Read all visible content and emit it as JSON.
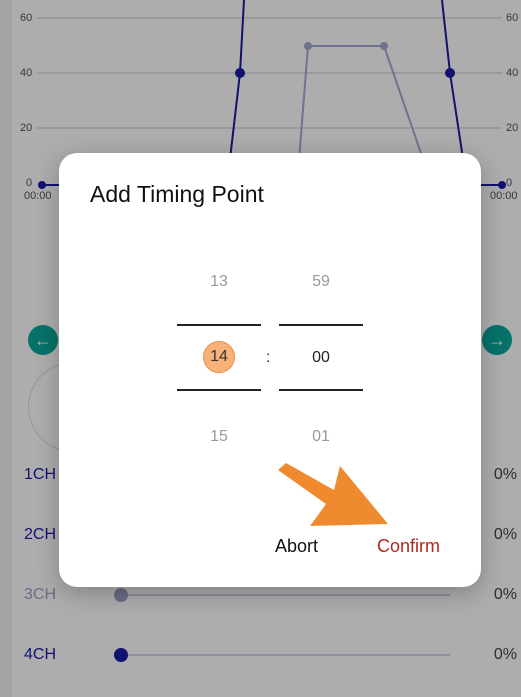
{
  "background_chart": {
    "y_ticks": [
      "60",
      "40",
      "20",
      "0"
    ],
    "y_ticks_right": [
      "60",
      "40",
      "20",
      "0"
    ],
    "time_start": "00:00",
    "time_end": "00:00"
  },
  "channels": [
    {
      "label": "1CH",
      "value": "0%",
      "dim": false
    },
    {
      "label": "2CH",
      "value": "0%",
      "dim": false
    },
    {
      "label": "3CH",
      "value": "0%",
      "dim": true
    },
    {
      "label": "4CH",
      "value": "0%",
      "dim": false
    }
  ],
  "dialog": {
    "title": "Add Timing Point",
    "hours": {
      "prev": "13",
      "current": "14",
      "next": "15"
    },
    "separator": ":",
    "minutes": {
      "prev": "59",
      "current": "00",
      "next": "01"
    },
    "abort_label": "Abort",
    "confirm_label": "Confirm"
  },
  "colors": {
    "accent": "#b3261e",
    "highlight": "#f7b27a",
    "channel_blue": "#1a1aa6",
    "annotation_arrow": "#ef8a2e"
  },
  "icons": {
    "nav_left": "arrow-left-icon",
    "nav_right": "arrow-right-icon",
    "annotation": "pointer-arrow-icon"
  }
}
